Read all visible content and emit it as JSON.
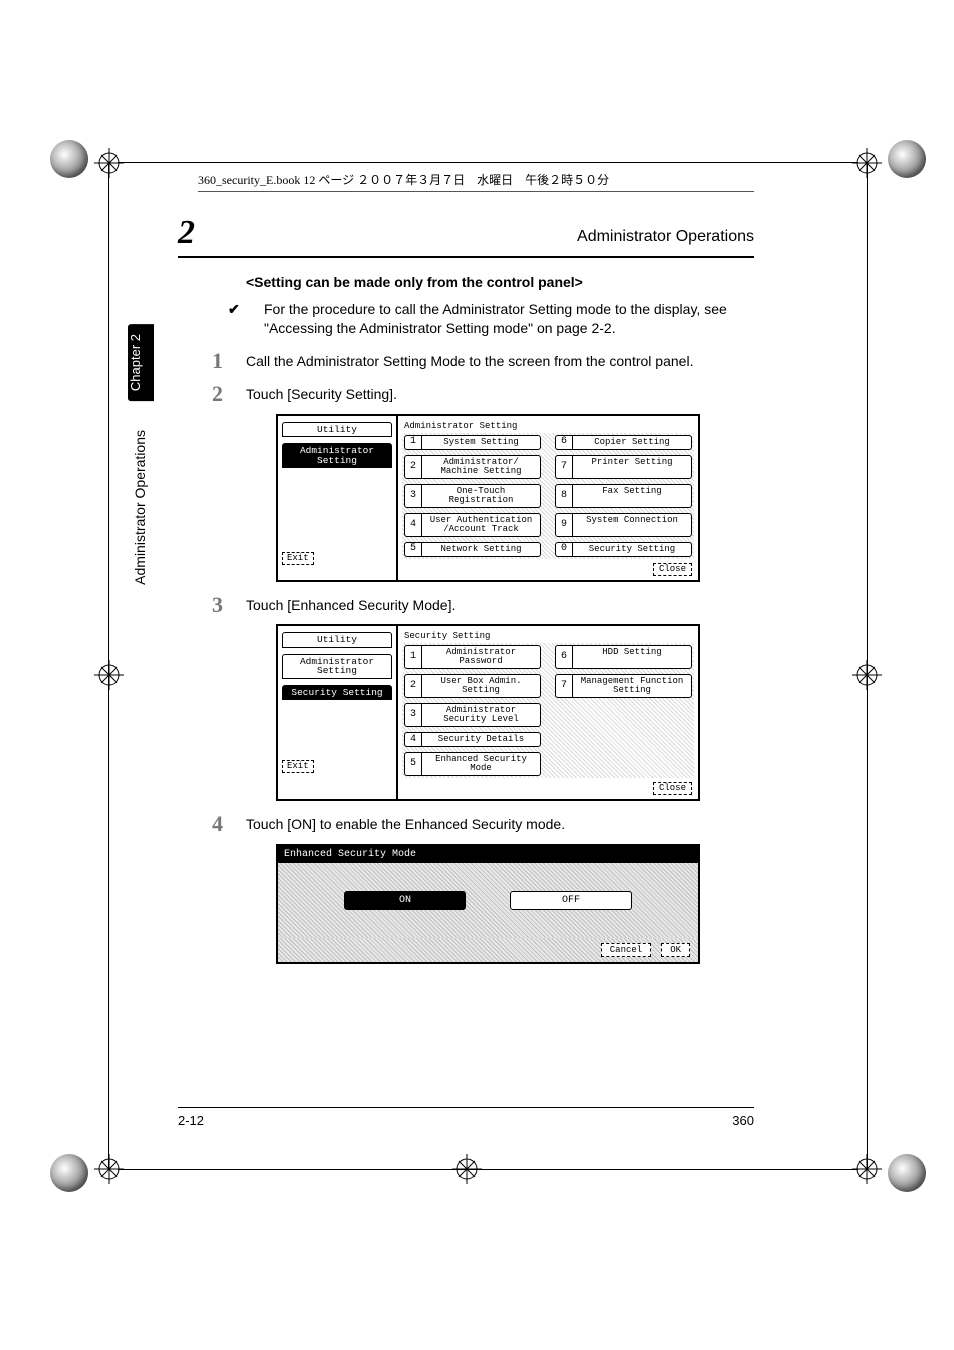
{
  "print_header": "360_security_E.book  12 ページ  ２００７年３月７日　水曜日　午後２時５０分",
  "section": {
    "number": "2",
    "title": "Administrator Operations"
  },
  "sidebar": {
    "chapter_tab": "Chapter 2",
    "vert_label": "Administrator Operations"
  },
  "subheading": "<Setting can be made only from the control panel>",
  "checkmark": "✔",
  "check_text": "For the procedure to call the Administrator Setting mode to the display, see \"Accessing the Administrator Setting mode\" on page 2-2.",
  "steps": {
    "s1": {
      "n": "1",
      "text": "Call the Administrator Setting Mode to the screen from the control panel."
    },
    "s2": {
      "n": "2",
      "text": "Touch [Security Setting]."
    },
    "s3": {
      "n": "3",
      "text": "Touch [Enhanced Security Mode]."
    },
    "s4": {
      "n": "4",
      "text": "Touch [ON] to enable the Enhanced Security mode."
    }
  },
  "lcd1": {
    "side_utility": "Utility",
    "side_admin": "Administrator Setting",
    "main_title": "Administrator Setting",
    "items": [
      {
        "n": "1",
        "label": "System Setting"
      },
      {
        "n": "6",
        "label": "Copier Setting"
      },
      {
        "n": "2",
        "label": "Administrator/ Machine Setting"
      },
      {
        "n": "7",
        "label": "Printer Setting"
      },
      {
        "n": "3",
        "label": "One-Touch Registration"
      },
      {
        "n": "8",
        "label": "Fax Setting"
      },
      {
        "n": "4",
        "label": "User Authentication /Account Track"
      },
      {
        "n": "9",
        "label": "System Connection"
      },
      {
        "n": "5",
        "label": "Network Setting"
      },
      {
        "n": "0",
        "label": "Security Setting"
      }
    ],
    "exit": "Exit",
    "close": "Close"
  },
  "lcd2": {
    "side_utility": "Utility",
    "side_admin": "Administrator Setting",
    "side_security": "Security Setting",
    "main_title": "Security Setting",
    "left_items": [
      {
        "n": "1",
        "label": "Administrator Password"
      },
      {
        "n": "2",
        "label": "User Box Admin. Setting"
      },
      {
        "n": "3",
        "label": "Administrator Security Level"
      },
      {
        "n": "4",
        "label": "Security Details"
      },
      {
        "n": "5",
        "label": "Enhanced Security Mode"
      }
    ],
    "right_items": [
      {
        "n": "6",
        "label": "HDD Setting"
      },
      {
        "n": "7",
        "label": "Management Function Setting"
      }
    ],
    "exit": "Exit",
    "close": "Close"
  },
  "lcd3": {
    "title": "Enhanced Security Mode",
    "on": "ON",
    "off": "OFF",
    "cancel": "Cancel",
    "ok": "OK"
  },
  "footer": {
    "left": "2-12",
    "right": "360"
  }
}
